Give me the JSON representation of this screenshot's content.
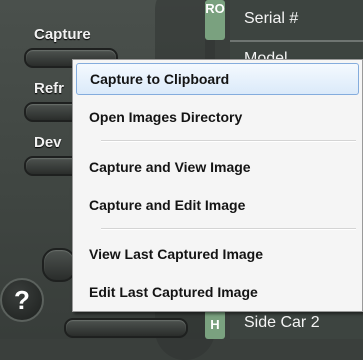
{
  "app_panel": {
    "labels": {
      "capture": "Capture",
      "refresh": "Refr",
      "devices": "Dev"
    },
    "help_button": "?",
    "tabs": {
      "top": "RO",
      "bottom": "H"
    },
    "fields": {
      "serial": "Serial #",
      "model": "Model",
      "side_car": "Side Car 2"
    }
  },
  "context_menu": {
    "items": [
      {
        "label": "Capture to Clipboard",
        "highlighted": true
      },
      {
        "label": "Open Images Directory"
      },
      {
        "label": "Capture and View Image"
      },
      {
        "label": "Capture and Edit Image"
      },
      {
        "label": "View Last Captured Image"
      },
      {
        "label": "Edit Last Captured Image"
      }
    ]
  },
  "colors": {
    "highlight_border": "#84acdd",
    "menu_bg": "#f5f5f5",
    "panel_bg": "#3d4440",
    "tab_green": "#7aa17f"
  }
}
